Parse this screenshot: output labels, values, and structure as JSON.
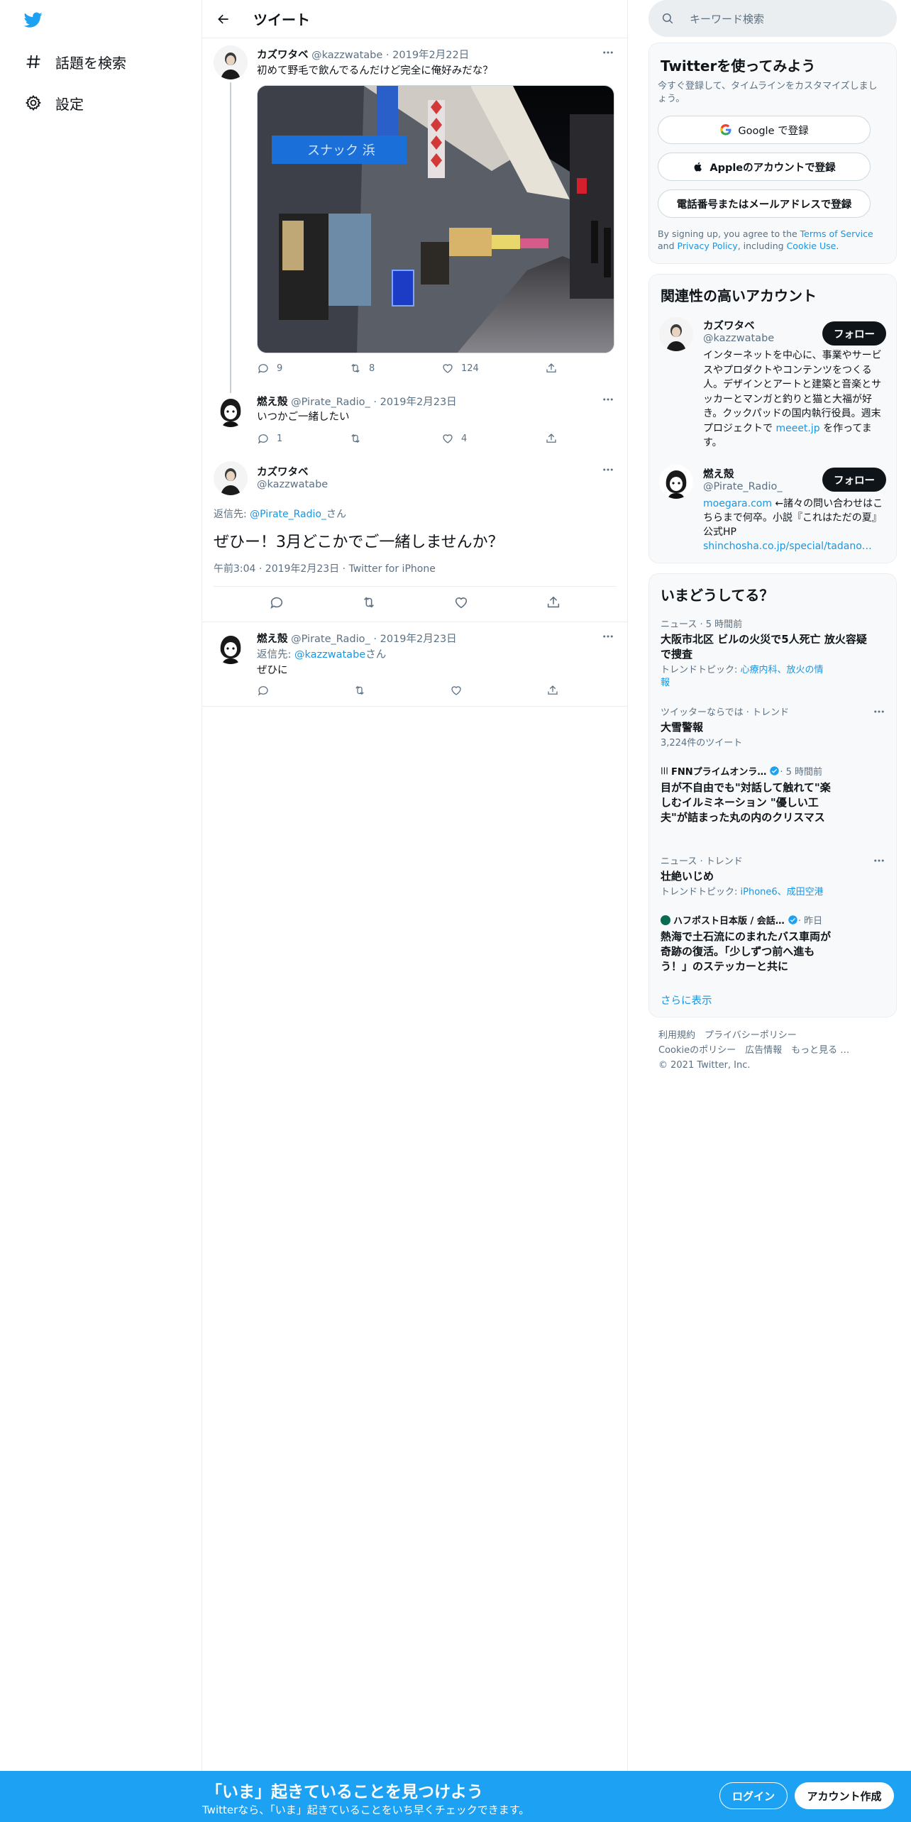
{
  "nav": {
    "explore_label": "話題を検索",
    "settings_label": "設定"
  },
  "header": {
    "title": "ツイート"
  },
  "tweets": [
    {
      "name": "カズワタベ",
      "handle": "@kazzwatabe",
      "date": "2019年2月22日",
      "text": "初めて野毛で飲んでるんだけど完全に俺好みだな？",
      "replies": "9",
      "retweets": "8",
      "likes": "124"
    },
    {
      "name": "燃え殻",
      "handle": "@Pirate_Radio_",
      "date": "2019年2月23日",
      "text": "いつかご一緒したい",
      "replies": "1",
      "retweets": "",
      "likes": "4"
    }
  ],
  "focus": {
    "name": "カズワタベ",
    "handle": "@kazzwatabe",
    "reply_prefix": "返信先: ",
    "reply_to": "@Pirate_Radio_",
    "reply_suffix": "さん",
    "text": "ぜひー！3月どこかでご一緒しませんか？",
    "meta": "午前3:04 · 2019年2月23日 · Twitter for iPhone"
  },
  "reply": {
    "name": "燃え殻",
    "handle": "@Pirate_Radio_",
    "date": "2019年2月23日",
    "reply_prefix": "返信先: ",
    "reply_to": "@kazzwatabe",
    "reply_suffix": "さん",
    "text": "ぜひに"
  },
  "search": {
    "placeholder": "キーワード検索"
  },
  "signup": {
    "title": "Twitterを使ってみよう",
    "subtitle": "今すぐ登録して、タイムラインをカスタマイズしましょう。",
    "google": "Google で登録",
    "apple": "Appleのアカウントで登録",
    "phone": "電話番号またはメールアドレスで登録",
    "legal_1": "By signing up, you agree to the ",
    "terms": "Terms of Service",
    "legal_2": " and ",
    "privacy": "Privacy Policy",
    "legal_3": ", including ",
    "cookie": "Cookie Use",
    "legal_4": "."
  },
  "relevant": {
    "title": "関連性の高いアカウント",
    "follow": "フォロー",
    "accounts": [
      {
        "name": "カズワタベ",
        "handle": "@kazzwatabe",
        "bio": "インターネットを中心に、事業やサービスやプロダクトやコンテンツをつくる人。デザインとアートと建築と音楽とサッカーとマンガと釣りと猫と大福が好き。クックパッドの国内執行役員。週末プロジェクトで ",
        "bio_link": "meeet.jp",
        "bio_end": " を作ってます。"
      },
      {
        "name": "燃え殻",
        "handle": "@Pirate_Radio_",
        "bio_link": "moegara.com",
        "bio": " ←諸々の問い合わせはこちらまで何卒。小説『これはただの夏』公式HP",
        "bio_link2": "shinchosha.co.jp/special/tadano…"
      }
    ]
  },
  "trends": {
    "title": "いまどうしてる？",
    "items": [
      {
        "meta": "ニュース · 5 時間前",
        "title": "大阪市北区 ビルの火災で5人死亡 放火容疑で捜査",
        "sub_prefix": "トレンドトピック: ",
        "sub_links": "心療内科、放火の情報"
      },
      {
        "meta": "ツイッターならでは · トレンド",
        "title": "大雪警報",
        "sub": "3,224件のツイート"
      },
      {
        "meta": "FNNプライムオンラ…",
        "meta_time": " · 5 時間前",
        "title": "目が不自由でも\"対話して触れて\"楽しむイルミネーション \"優しい工夫\"が詰まった丸の内のクリスマス"
      },
      {
        "meta": "ニュース · トレンド",
        "title": "壮絶いじめ",
        "sub_prefix": "トレンドトピック: ",
        "sub_links": "iPhone6、成田空港"
      },
      {
        "meta": "ハフポスト日本版 / 会話…",
        "meta_time": " · 昨日",
        "title": "熱海で土石流にのまれたバス車両が奇跡の復活。「少しずつ前へ進もう！」のステッカーと共に"
      }
    ],
    "show_more": "さらに表示"
  },
  "footer": {
    "line1": "利用規約　プライバシーポリシー",
    "line2": "Cookieのポリシー　広告情報　もっと見る …",
    "line3": "© 2021 Twitter, Inc."
  },
  "banner": {
    "headline": "「いま」起きていることを見つけよう",
    "sub": "Twitterなら、「いま」起きていることをいち早くチェックできます。",
    "login": "ログイン",
    "signup": "アカウント作成"
  },
  "colors": {
    "accent": "#1da1f2",
    "link": "#1b95e0",
    "text": "#0f1419",
    "muted": "#5b7083"
  }
}
